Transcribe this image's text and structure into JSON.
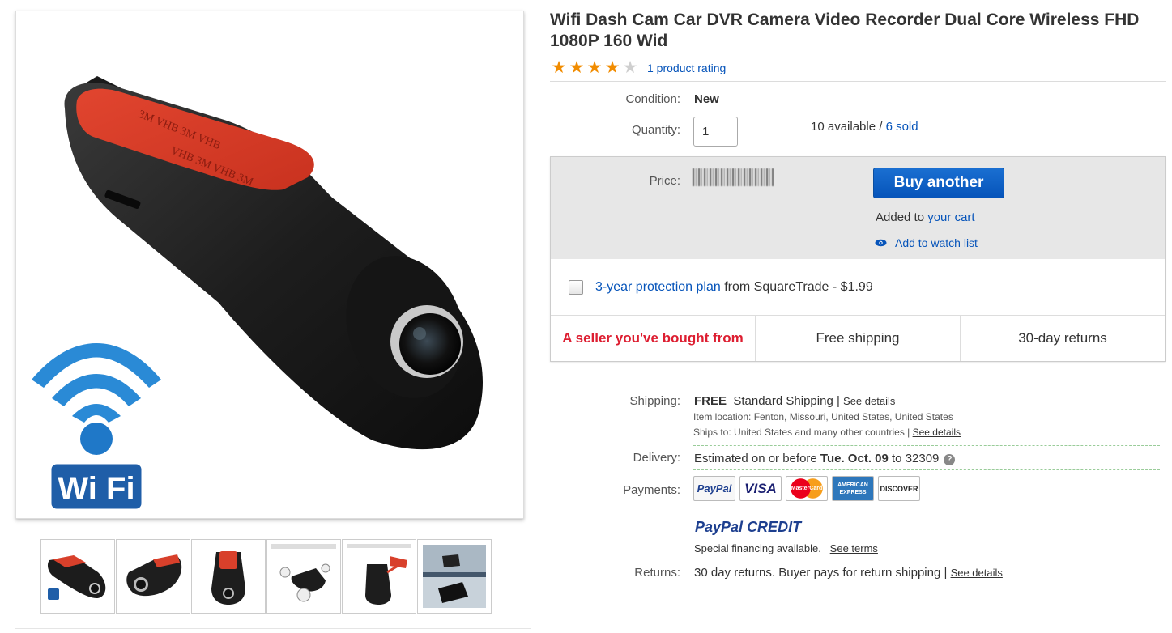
{
  "product": {
    "title": "Wifi Dash Cam Car DVR Camera Video Recorder Dual Core Wireless FHD 1080P 160 Wid",
    "rating_value": 4,
    "rating_max": 5,
    "rating_link": "1 product rating"
  },
  "gallery": {
    "wifi_badge": "Wi Fi",
    "thumbnails": [
      "thumb-1",
      "thumb-2",
      "thumb-3",
      "thumb-4",
      "thumb-5",
      "thumb-6"
    ]
  },
  "condition": {
    "label": "Condition:",
    "value": "New"
  },
  "quantity": {
    "label": "Quantity:",
    "value": "1",
    "available": "10 available",
    "separator": " / ",
    "sold_link": "6 sold"
  },
  "buy_box": {
    "price_label": "Price:",
    "buy_button": "Buy another",
    "added_prefix": "Added to ",
    "cart_link": "your cart",
    "watch_link": "Add to watch list",
    "protection_link": "3-year protection plan",
    "protection_rest": " from SquareTrade - $1.99",
    "features": [
      "A seller you've bought from",
      "Free shipping",
      "30-day returns"
    ]
  },
  "shipping": {
    "label": "Shipping:",
    "free": "FREE",
    "service": "Standard Shipping",
    "bar": " | ",
    "details_link": "See details",
    "item_location": "Item location:  Fenton, Missouri, United States, United States",
    "ships_to": "Ships to:  United States and many other countries | ",
    "ships_details_link": "See details"
  },
  "delivery": {
    "label": "Delivery:",
    "prefix": "Estimated on or before ",
    "date": "Tue. Oct. 09",
    "suffix": " to 32309",
    "help": "?"
  },
  "payments": {
    "label": "Payments:",
    "logos": [
      "PayPal",
      "VISA",
      "MasterCard",
      "AMERICAN EXPRESS",
      "DISCOVER"
    ],
    "credit_paypal": "PayPal",
    "credit_word": "CREDIT",
    "financing": "Special financing available.",
    "terms_link": "See terms"
  },
  "returns": {
    "label": "Returns:",
    "text": "30 day returns. Buyer pays for return shipping | ",
    "details_link": "See details"
  },
  "colors": {
    "link": "#0654ba",
    "star": "#f18c00",
    "seller_red": "#dd1e31",
    "button_blue": "#0654ba"
  }
}
